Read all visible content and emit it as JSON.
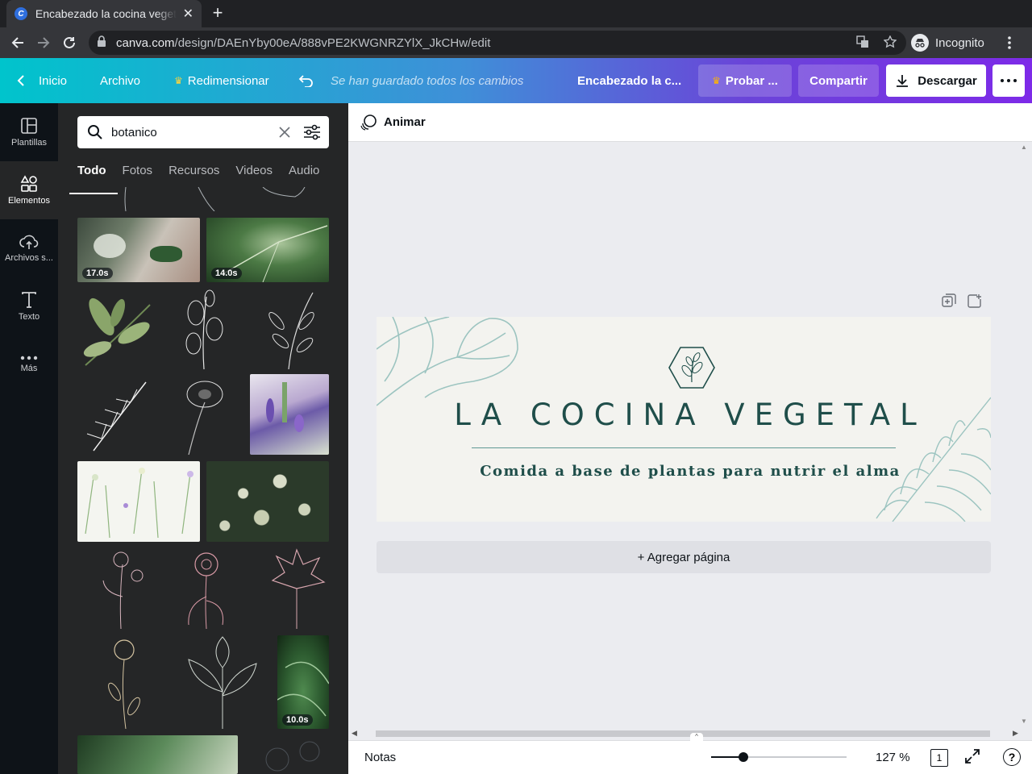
{
  "browser": {
    "tab_title": "Encabezado la cocina vegetal",
    "tab_favicon_letter": "C",
    "url_domain": "canva.com",
    "url_path": "/design/DAEnYby00eA/888vPE2KWGNRZYlX_JkCHw/edit",
    "profile_label": "Incognito"
  },
  "header": {
    "home_label": "Inicio",
    "file_label": "Archivo",
    "resize_label": "Redimensionar",
    "saved_status": "Se han guardado todos los cambios",
    "doc_title": "Encabezado la c...",
    "try_label": "Probar ...",
    "share_label": "Compartir",
    "download_label": "Descargar"
  },
  "rail": {
    "items": [
      {
        "label": "Plantillas",
        "icon": "templates-icon"
      },
      {
        "label": "Elementos",
        "icon": "elements-icon"
      },
      {
        "label": "Archivos s...",
        "icon": "upload-icon"
      },
      {
        "label": "Texto",
        "icon": "text-icon"
      },
      {
        "label": "Más",
        "icon": "more-icon"
      }
    ]
  },
  "panel": {
    "search_value": "botanico",
    "tabs": [
      "Todo",
      "Fotos",
      "Recursos",
      "Videos",
      "Audio"
    ],
    "video_durations": [
      "17.0s",
      "14.0s",
      "10.0s"
    ]
  },
  "toolbar": {
    "animate_label": "Animar"
  },
  "design": {
    "headline": "LA COCINA VEGETAL",
    "subtitle": "Comida a base de plantas para nutrir el alma",
    "bg_color": "#f3f3ef",
    "text_color": "#1f4e4a",
    "accent_color": "#9cc4c0"
  },
  "workspace": {
    "add_page_label": "+ Agregar página"
  },
  "footer": {
    "notes_label": "Notas",
    "zoom_label": "127 %",
    "zoom_fraction": 0.24,
    "page_count": "1"
  },
  "colors": {
    "brand_teal": "#00c4cc",
    "brand_purple": "#7d2ae8",
    "rail_bg": "#0e1318",
    "panel_bg": "#252627"
  }
}
